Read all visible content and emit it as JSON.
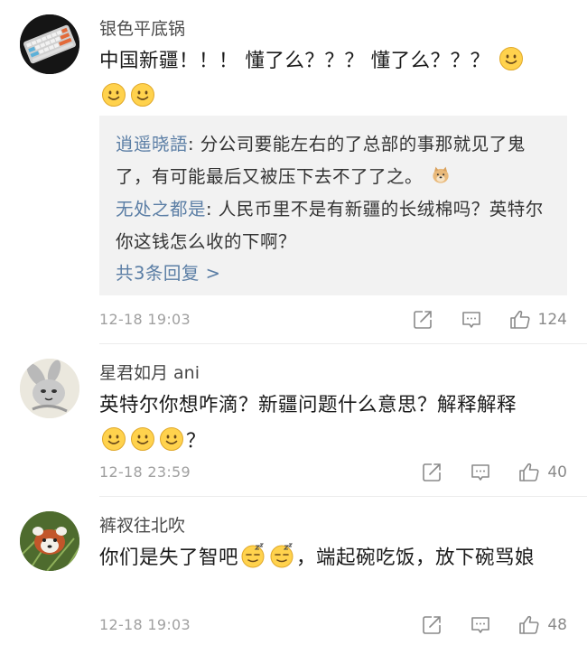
{
  "comments": [
    {
      "user": "银色平底锅",
      "text": "中国新疆！！！ 懂了么？？？ 懂了么？？？",
      "timestamp": "12-18 19:03",
      "likes": "124",
      "avatar_icon": "keyboard-avatar",
      "emoji_icons": [
        "smile-emoji",
        "smile-emoji",
        "smile-emoji"
      ],
      "replies": [
        {
          "user": "逍遥晓語",
          "sep": ": ",
          "text": "分公司要能左右的了总部的事那就见了鬼了，有可能最后又被压下去不了了之。",
          "emoji": "doge-emoji"
        },
        {
          "user": "无处之都是",
          "sep": ": ",
          "text": "人民币里不是有新疆的长绒棉吗？英特尔你这钱怎么收的下啊？"
        }
      ],
      "more_replies": "共3条回复 >"
    },
    {
      "user": "星君如月 ani",
      "text": "英特尔你想咋滴？新疆问题什么意思？解释解释",
      "trail": "？",
      "timestamp": "12-18 23:59",
      "likes": "40",
      "avatar_icon": "rabbit-avatar",
      "emoji_icons": [
        "smile-emoji",
        "smile-emoji",
        "smile-emoji"
      ]
    },
    {
      "user": "裤衩往北吹",
      "text_a": "你们是失了智吧",
      "text_b": "，端起碗吃饭，放下碗骂娘",
      "timestamp": "12-18 19:03",
      "likes": "48",
      "avatar_icon": "red-panda-avatar",
      "emoji_icons": [
        "sleepy-emoji",
        "sleepy-emoji"
      ]
    }
  ],
  "icons": {
    "share": "share-icon",
    "comment": "comment-icon",
    "like": "like-icon"
  },
  "colors": {
    "link": "#5b7ea5",
    "meta": "#a0a0a0",
    "reply_bg": "#f2f2f2",
    "emoji": "#ffd24d"
  }
}
